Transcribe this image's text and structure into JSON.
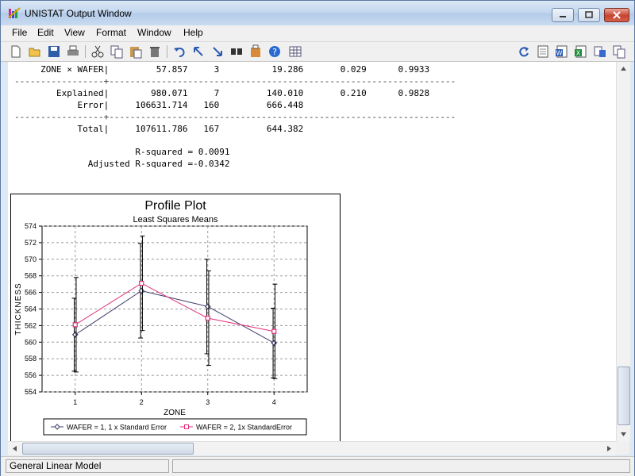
{
  "window": {
    "title": "UNISTAT Output Window"
  },
  "menu": [
    "File",
    "Edit",
    "View",
    "Format",
    "Window",
    "Help"
  ],
  "toolbar_left": [
    "new-icon",
    "open-icon",
    "save-icon",
    "print-icon",
    "cut-icon",
    "copy-icon",
    "paste-icon",
    "delete-icon",
    "undo-icon",
    "go-top-icon",
    "go-bottom-icon",
    "find-icon",
    "properties-icon",
    "help-icon",
    "grid-icon"
  ],
  "toolbar_right": [
    "refresh-icon",
    "notepad-icon",
    "word-icon",
    "excel-icon",
    "export-icon",
    "copy-all-icon"
  ],
  "output": {
    "line1": "     ZONE × WAFER|         57.857     3          19.286       0.029      0.9933",
    "sep1": "-----------------+------------------------------------------------------------------",
    "line2": "        Explained|        980.071     7         140.010       0.210      0.9828",
    "line3": "            Error|     106631.714   160         666.448",
    "sep2": "-----------------+------------------------------------------------------------------",
    "line4": "            Total|     107611.786   167         644.382",
    "rsq": "                       R-squared = 0.0091",
    "adjrsq": "              Adjusted R-squared =-0.0342"
  },
  "chart_data": {
    "type": "line",
    "title": "Profile Plot",
    "subtitle": "Least Squares Means",
    "xlabel": "ZONE",
    "ylabel": "THICKNESS",
    "categories": [
      "1",
      "2",
      "3",
      "4"
    ],
    "ylim": [
      554,
      574
    ],
    "yticks": [
      "554",
      "556",
      "558",
      "560",
      "562",
      "564",
      "566",
      "568",
      "570",
      "572",
      "574"
    ],
    "grid": true,
    "legend_position": "bottom",
    "series": [
      {
        "name": "WAFER = 1, 1 x Standard Error",
        "color": "#3a3a6a",
        "marker": "diamond",
        "values": [
          560.9,
          566.2,
          564.3,
          559.9
        ],
        "error": [
          4.4,
          5.7,
          5.7,
          4.2
        ]
      },
      {
        "name": "WAFER = 2, 1x StandardError",
        "color": "#e0307a",
        "marker": "square",
        "values": [
          562.1,
          567.1,
          562.9,
          561.3
        ],
        "error": [
          5.7,
          5.7,
          5.7,
          5.7
        ]
      }
    ]
  },
  "status": {
    "panel1": "General Linear Model"
  }
}
